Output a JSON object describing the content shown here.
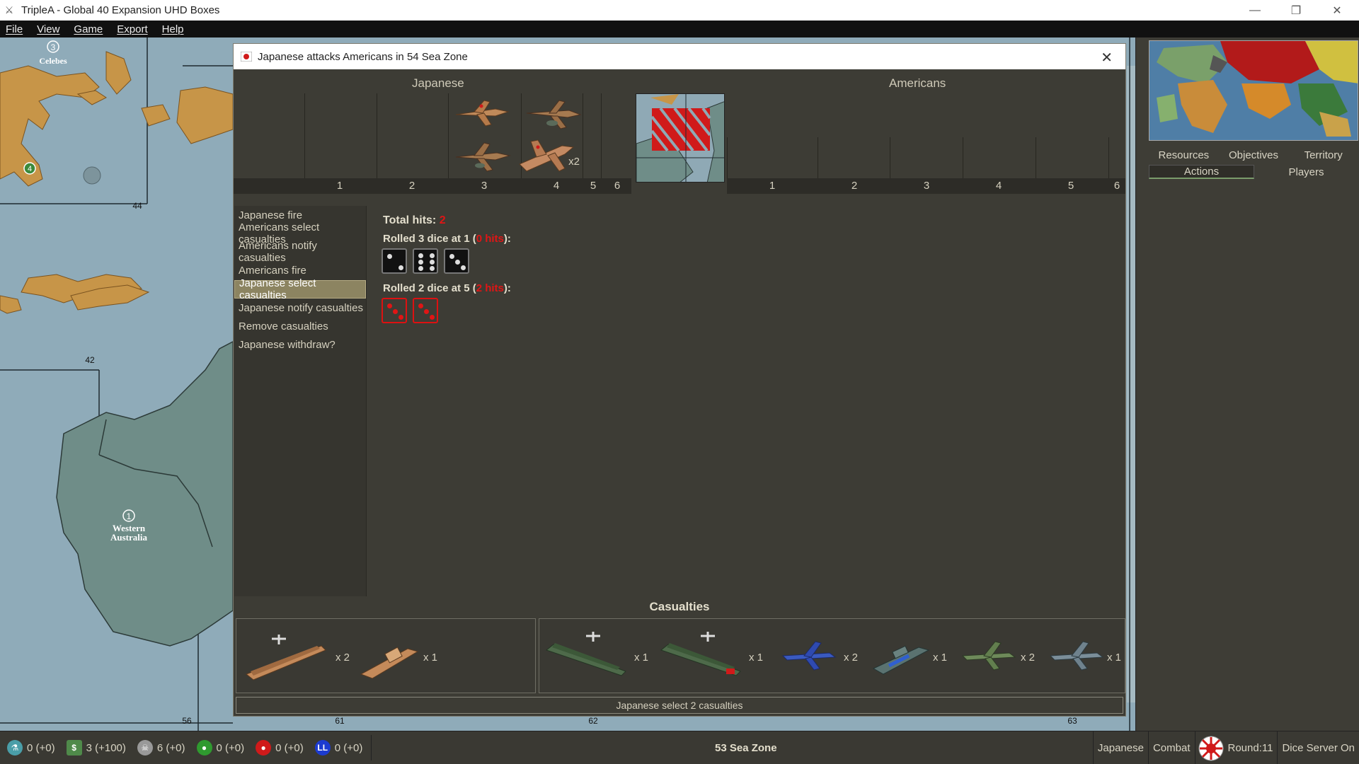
{
  "window": {
    "title": "TripleA - Global 40 Expansion UHD Boxes",
    "controls": [
      "—",
      "❐",
      "✕"
    ]
  },
  "menu": [
    "File",
    "View",
    "Game",
    "Export",
    "Help"
  ],
  "map": {
    "labels": {
      "celebes": "Celebes",
      "celebes_num": "3",
      "western_australia_1": "Western",
      "western_australia_2": "Australia",
      "wa_num": "1",
      "badge_4": "4",
      "z44": "44",
      "z42": "42",
      "z56": "56",
      "z61": "61",
      "z62": "62",
      "z63": "63"
    }
  },
  "right_panel": {
    "tabs_row1": [
      "Resources",
      "Objectives",
      "Territory"
    ],
    "tabs_row2": [
      "Actions",
      "Players"
    ],
    "active_tab": "Actions"
  },
  "battle": {
    "title": "Japanese attacks Americans in 54 Sea Zone",
    "attacker": "Japanese",
    "defender": "Americans",
    "attacker_columns": [
      "1",
      "2",
      "3",
      "4",
      "5",
      "6"
    ],
    "defender_columns": [
      "1",
      "2",
      "3",
      "4",
      "5",
      "6"
    ],
    "attacker_unit_count": "x2",
    "steps": [
      "Japanese fire",
      "Americans select casualties",
      "Americans notify casualties",
      "Americans fire",
      "Japanese select casualties",
      "Japanese notify casualties",
      "Remove casualties",
      "Japanese withdraw?"
    ],
    "active_step": "Japanese select casualties",
    "results": {
      "total_label": "Total hits: ",
      "total_value": "2",
      "roll1_prefix": "Rolled 3 dice at 1 (",
      "roll1_hits": "0 hits",
      "roll1_suffix": "):",
      "roll1_dice": [
        2,
        6,
        3
      ],
      "roll2_prefix": "Rolled 2 dice at 5 (",
      "roll2_hits": "2 hits",
      "roll2_suffix": "):",
      "roll2_dice": [
        3,
        3
      ]
    },
    "casualties_title": "Casualties",
    "casualties_japanese": [
      {
        "unit": "carrier",
        "count": "x 2"
      },
      {
        "unit": "transport",
        "count": "x 1"
      }
    ],
    "casualties_american": [
      {
        "unit": "carrier",
        "count": "x 1"
      },
      {
        "unit": "carrier-damaged",
        "count": "x 1"
      },
      {
        "unit": "fighter",
        "count": "x 2"
      },
      {
        "unit": "submarine",
        "count": "x 1"
      },
      {
        "unit": "tactical-bomber",
        "count": "x 2"
      },
      {
        "unit": "fighter-grey",
        "count": "x 1"
      }
    ],
    "status": "Japanese select 2 casualties"
  },
  "bottom_bar": {
    "resources": [
      {
        "name": "pus",
        "value": "0 (+0)",
        "color": "#4a9ea8"
      },
      {
        "name": "tech",
        "value": "3 (+100)",
        "color": "#4f8a4a"
      },
      {
        "name": "vp",
        "value": "6 (+0)",
        "color": "#999999"
      },
      {
        "name": "green-token",
        "value": "0 (+0)",
        "color": "#2f9a2f"
      },
      {
        "name": "red-token",
        "value": "0 (+0)",
        "color": "#d01a1a"
      },
      {
        "name": "blue-token",
        "value": "0 (+0)",
        "color": "#1c3bd0"
      }
    ],
    "zone": "53 Sea Zone",
    "player": "Japanese",
    "phase": "Combat",
    "round": "Round:11",
    "dice": "Dice Server On"
  }
}
